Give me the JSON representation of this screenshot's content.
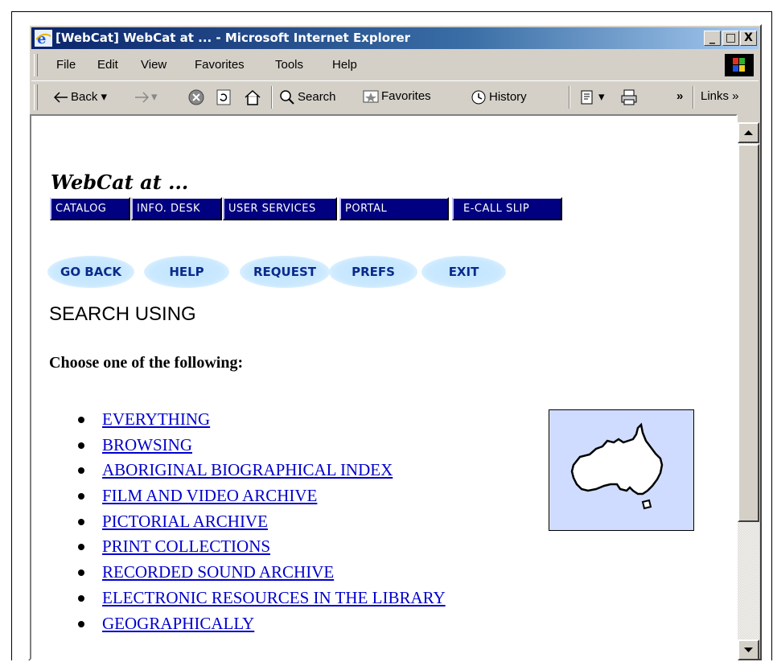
{
  "window": {
    "title": "[WebCat] WebCat at ... - Microsoft Internet Explorer",
    "controls": [
      "_",
      "□",
      "X"
    ]
  },
  "menubar": {
    "items": [
      "File",
      "Edit",
      "View",
      "Favorites",
      "Tools",
      "Help"
    ]
  },
  "toolbar": {
    "back": "Back",
    "search": "Search",
    "favorites": "Favorites",
    "history": "History",
    "more": "»",
    "links": "Links »"
  },
  "page": {
    "heading": "WebCat at ...",
    "nav_tabs": [
      "CATALOG",
      "INFO. DESK",
      "USER SERVICES",
      "PORTAL",
      "E-CALL SLIP"
    ],
    "buttons": [
      "GO BACK",
      "HELP",
      "REQUEST",
      "PREFS",
      "EXIT"
    ],
    "section_title": "SEARCH USING",
    "instruction": "Choose one of the following:",
    "options": [
      "EVERYTHING",
      "BROWSING",
      "ABORIGINAL BIOGRAPHICAL INDEX",
      "FILM AND VIDEO ARCHIVE",
      "PICTORIAL ARCHIVE",
      "PRINT COLLECTIONS",
      "RECORDED SOUND ARCHIVE",
      "ELECTRONIC RESOURCES IN THE LIBRARY",
      "GEOGRAPHICALLY"
    ]
  },
  "colors": {
    "title_gradient_start": "#0a246a",
    "nav_bg": "#000080",
    "link": "#0000cc",
    "button_pill": "#bfe4ff",
    "map_bg": "#cfdcff"
  },
  "icons": [
    "ie-logo-icon",
    "windows-flag-icon",
    "back-arrow-icon",
    "forward-arrow-icon",
    "stop-icon",
    "refresh-icon",
    "home-icon",
    "search-icon",
    "favorites-icon",
    "history-icon",
    "edit-icon",
    "print-icon",
    "australia-map-image"
  ]
}
